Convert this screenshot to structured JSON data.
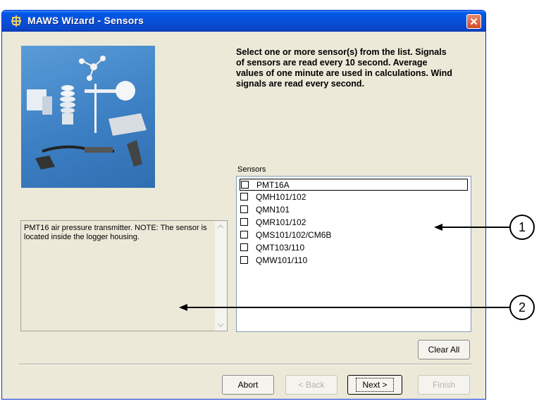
{
  "window": {
    "title": "MAWS Wizard - Sensors"
  },
  "instructions": "Select one or more sensor(s) from the list. Signals of sensors are read every 10 second. Average values of one minute are used in calculations. Wind signals are read every second.",
  "sensors": {
    "label": "Sensors",
    "items": [
      {
        "label": "PMT16A",
        "checked": false
      },
      {
        "label": "QMH101/102",
        "checked": false
      },
      {
        "label": "QMN101",
        "checked": false
      },
      {
        "label": "QMR101/102",
        "checked": false
      },
      {
        "label": "QMS101/102/CM6B",
        "checked": false
      },
      {
        "label": "QMT103/110",
        "checked": false
      },
      {
        "label": "QMW101/110",
        "checked": false
      }
    ]
  },
  "description": "PMT16 air pressure transmitter. NOTE: The sensor is located inside the logger housing.",
  "buttons": {
    "clear_all": "Clear All",
    "abort": "Abort",
    "back": "< Back",
    "next": "Next >",
    "finish": "Finish"
  },
  "callouts": [
    "1",
    "2"
  ],
  "colors": {
    "titlebar": "#0a4fd8",
    "dialog_bg": "#ece9d8",
    "image_bg": "#3c7fc3",
    "close_button": "#d54b2a"
  },
  "icons": {
    "app": "maws-icon",
    "close": "close-icon",
    "scroll_up": "scroll-up-arrow-icon",
    "scroll_down": "scroll-down-arrow-icon",
    "checkbox": "checkbox-icon"
  }
}
